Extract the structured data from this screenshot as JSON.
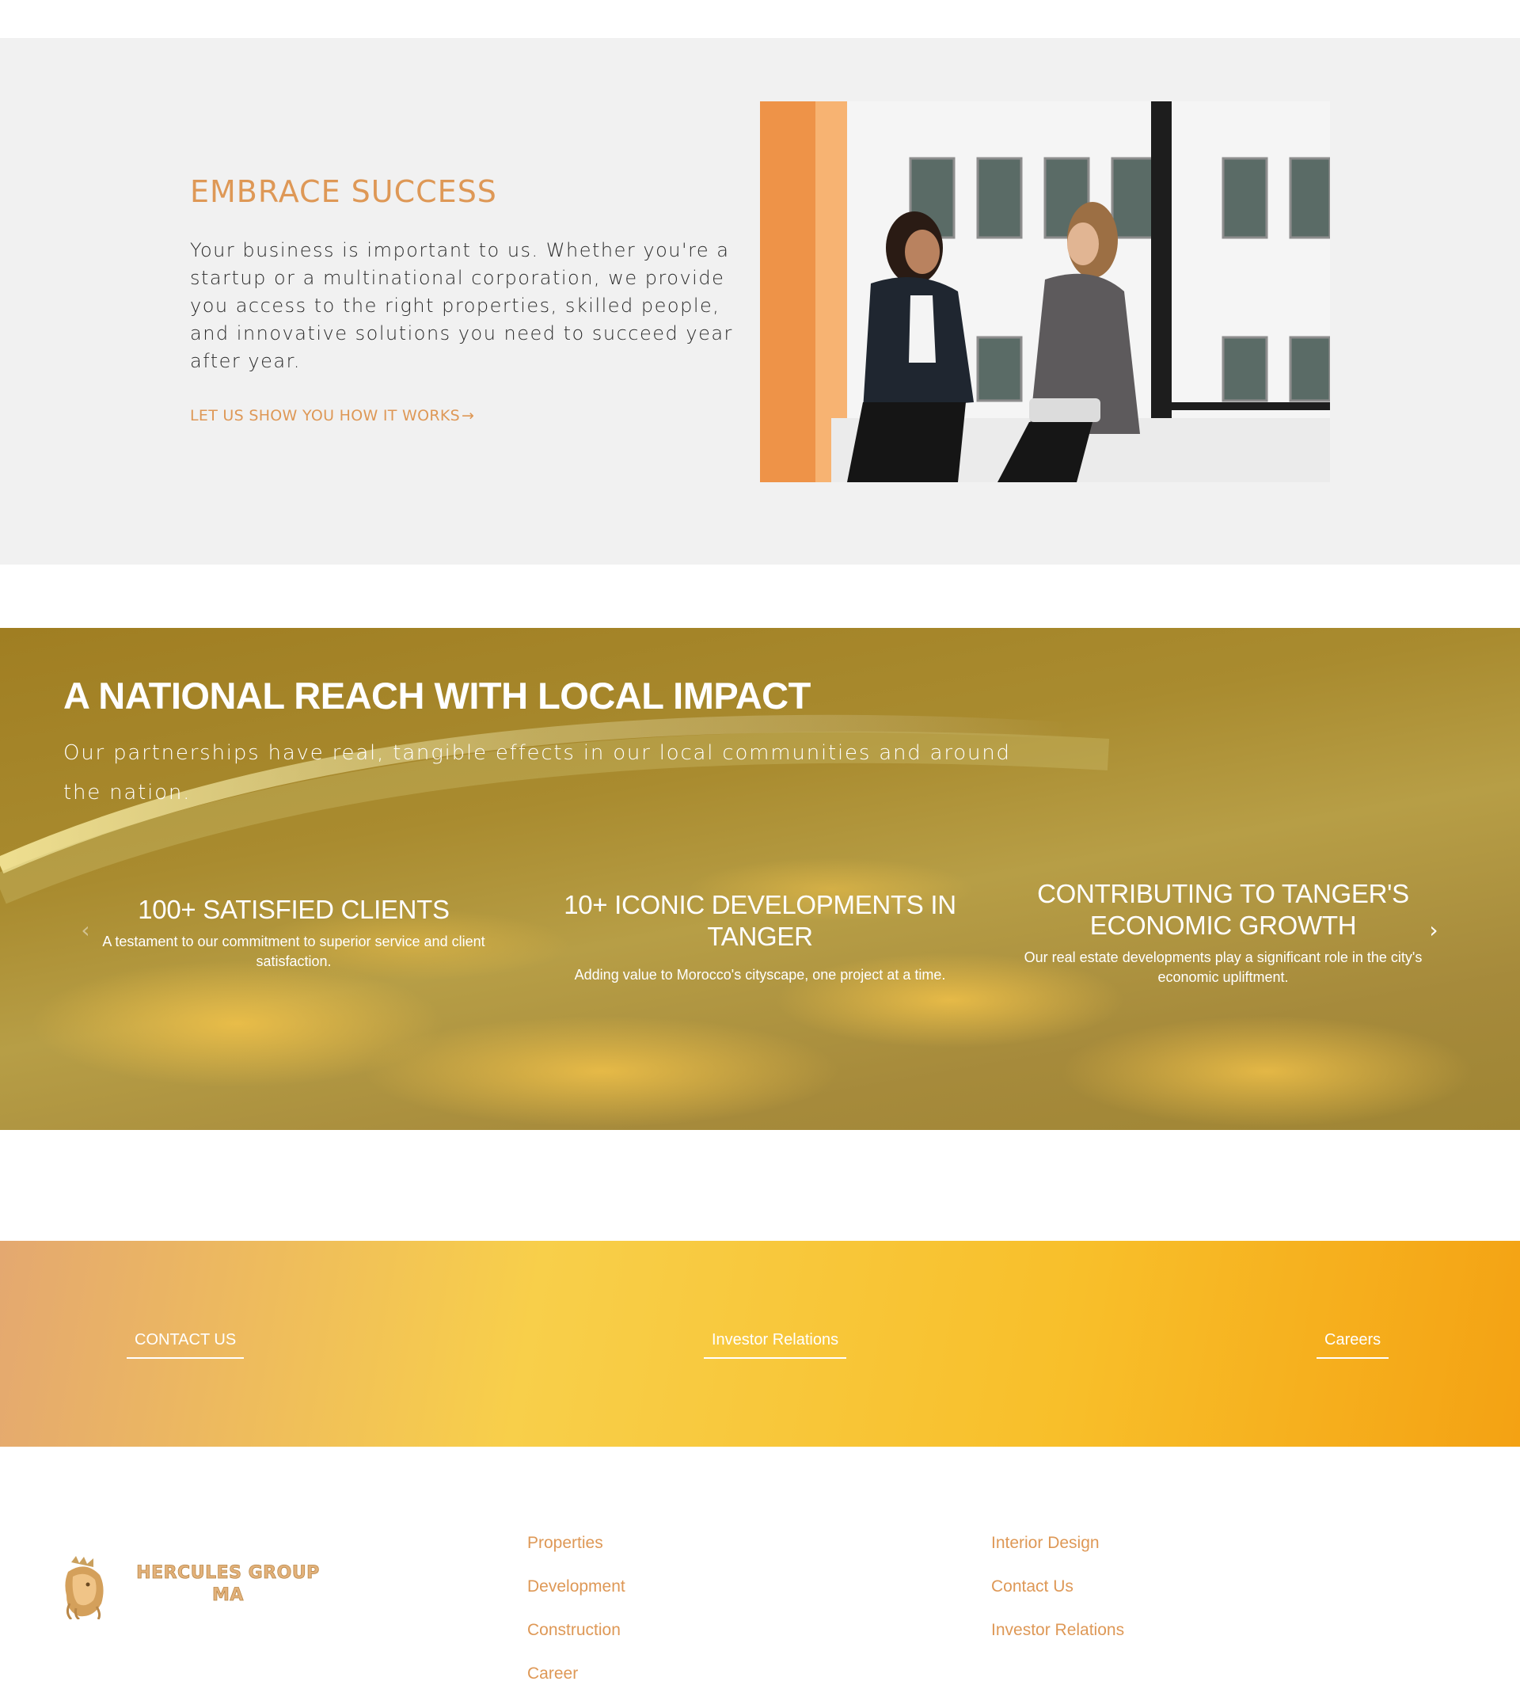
{
  "embrace": {
    "title": "EMBRACE SUCCESS",
    "body": "Your business is important to us. Whether you're a startup or a multinational corporation, we provide you access to the right properties, skilled people, and innovative solutions you need to succeed year after year.",
    "link_label": "LET US SHOW YOU HOW IT WORKS",
    "link_icon": "arrow-right-icon"
  },
  "reach": {
    "title": "A NATIONAL REACH WITH LOCAL IMPACT",
    "subtitle": "Our partnerships have real, tangible effects in our local communities and around the nation.",
    "stats": [
      {
        "title": "100+ SATISFIED CLIENTS",
        "text": "A testament to our commitment to superior service and client satisfaction."
      },
      {
        "title": "10+ ICONIC DEVELOPMENTS IN TANGER",
        "text": "Adding value to Morocco's cityscape, one project at a time."
      },
      {
        "title": "CONTRIBUTING TO TANGER'S ECONOMIC GROWTH",
        "text": "Our real estate developments play a significant role in the city's economic upliftment."
      }
    ],
    "prev_icon": "chevron-left-icon",
    "next_icon": "chevron-right-icon"
  },
  "cta": {
    "contact": "CONTACT US",
    "investor": "Investor Relations",
    "careers": "Careers"
  },
  "footer": {
    "logo_text_line1": "HERCULES GROUP",
    "logo_text_line2": "MA",
    "col1": [
      "Properties",
      "Development",
      "Construction",
      "Career"
    ],
    "col2": [
      "Interior Design",
      "Contact Us",
      "Investor Relations"
    ]
  },
  "colors": {
    "accent": "#de9856",
    "section_grey": "#f1f1f1",
    "reach_gold": "#a98b2f",
    "cta_yellow": "#f8cf4a",
    "cta_orange": "#f4a213"
  }
}
